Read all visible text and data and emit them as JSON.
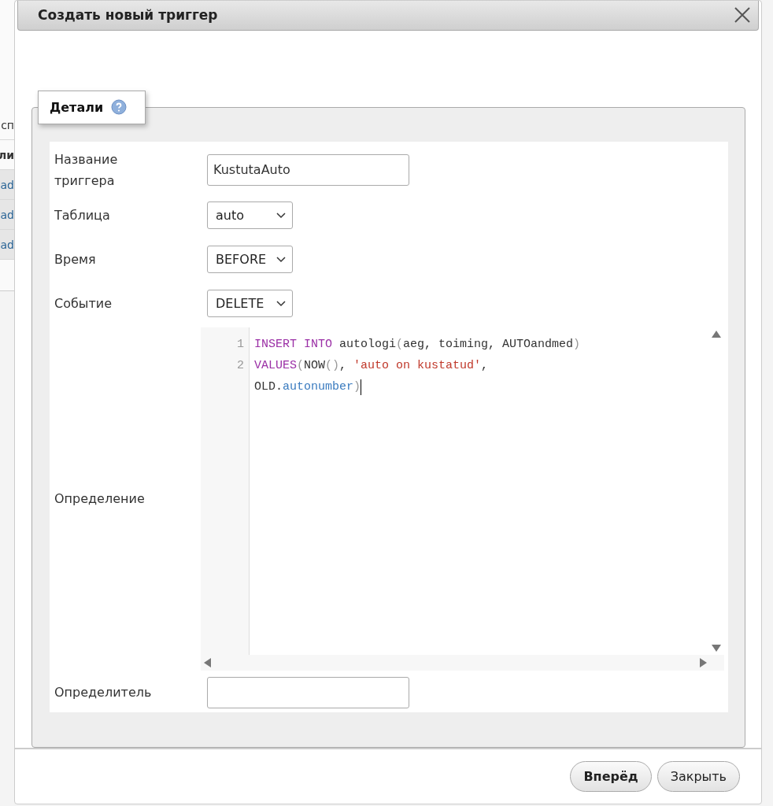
{
  "background": {
    "fragments": [
      {
        "text": "сп",
        "kind": "cell"
      },
      {
        "text": "ли",
        "kind": "heading"
      },
      {
        "text": "ad",
        "kind": "link"
      },
      {
        "text": "ad",
        "kind": "link"
      },
      {
        "text": "ad",
        "kind": "link"
      }
    ]
  },
  "dialog": {
    "title": "Создать новый триггер",
    "tab": {
      "label": "Детали"
    },
    "fields": [
      {
        "label": "Название триггера",
        "kind": "text",
        "value": "KustutaAuto"
      },
      {
        "label": "Таблица",
        "kind": "select",
        "value": "auto"
      },
      {
        "label": "Время",
        "kind": "select",
        "value": "BEFORE"
      },
      {
        "label": "Событие",
        "kind": "select",
        "value": "DELETE"
      },
      {
        "label": "Определение",
        "kind": "code",
        "lines": [
          {
            "number": "1",
            "tokens": [
              {
                "kind": "keyword",
                "text": "INSERT INTO"
              },
              {
                "kind": "plain",
                "text": " autologi"
              },
              {
                "kind": "paren",
                "text": "("
              },
              {
                "kind": "plain",
                "text": "aeg, toiming, AUTOandmed"
              },
              {
                "kind": "paren",
                "text": ")"
              }
            ]
          },
          {
            "number": "2",
            "tokens": [
              {
                "kind": "keyword",
                "text": "VALUES"
              },
              {
                "kind": "paren",
                "text": "("
              },
              {
                "kind": "plain",
                "text": "NOW"
              },
              {
                "kind": "paren",
                "text": "()"
              },
              {
                "kind": "plain",
                "text": ", "
              },
              {
                "kind": "string",
                "text": "'auto on kustatud'"
              },
              {
                "kind": "plain",
                "text": ","
              }
            ]
          },
          {
            "tokens": [
              {
                "kind": "plain",
                "text": "OLD."
              },
              {
                "kind": "property",
                "text": "autonumber"
              },
              {
                "kind": "paren",
                "text": ")"
              }
            ]
          }
        ]
      },
      {
        "label": "Определитель",
        "kind": "text"
      }
    ],
    "buttons": [
      {
        "label": "Вперёд",
        "primary": true
      },
      {
        "label": "Закрыть",
        "primary": false
      }
    ]
  }
}
